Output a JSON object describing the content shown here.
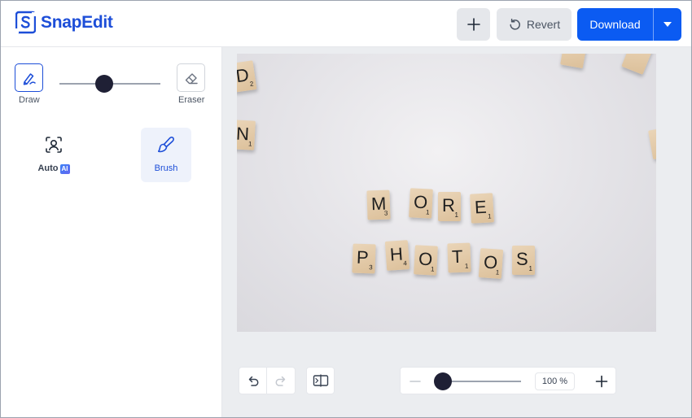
{
  "app": {
    "name": "SnapEdit",
    "accent": "#0b5bf2"
  },
  "header": {
    "add_icon": "plus-icon",
    "revert_label": "Revert",
    "download_label": "Download",
    "download_menu_icon": "caret-down-icon"
  },
  "sidebar": {
    "draw_label": "Draw",
    "eraser_label": "Eraser",
    "auto_label": "Auto",
    "ai_badge": "AI",
    "brush_label": "Brush",
    "selected_mode": "Brush",
    "selected_tool": "Draw"
  },
  "canvas": {
    "tiles": [
      {
        "ch": "M",
        "pt": "3"
      },
      {
        "ch": "O",
        "pt": "1"
      },
      {
        "ch": "R",
        "pt": "1"
      },
      {
        "ch": "E",
        "pt": "1"
      },
      {
        "ch": "P",
        "pt": "3"
      },
      {
        "ch": "H",
        "pt": "4"
      },
      {
        "ch": "O",
        "pt": "1"
      },
      {
        "ch": "T",
        "pt": "1"
      },
      {
        "ch": "O",
        "pt": "1"
      },
      {
        "ch": "S",
        "pt": "1"
      },
      {
        "ch": "D",
        "pt": "2"
      },
      {
        "ch": "N",
        "pt": "1"
      }
    ]
  },
  "zoom": {
    "value": "100 %"
  }
}
